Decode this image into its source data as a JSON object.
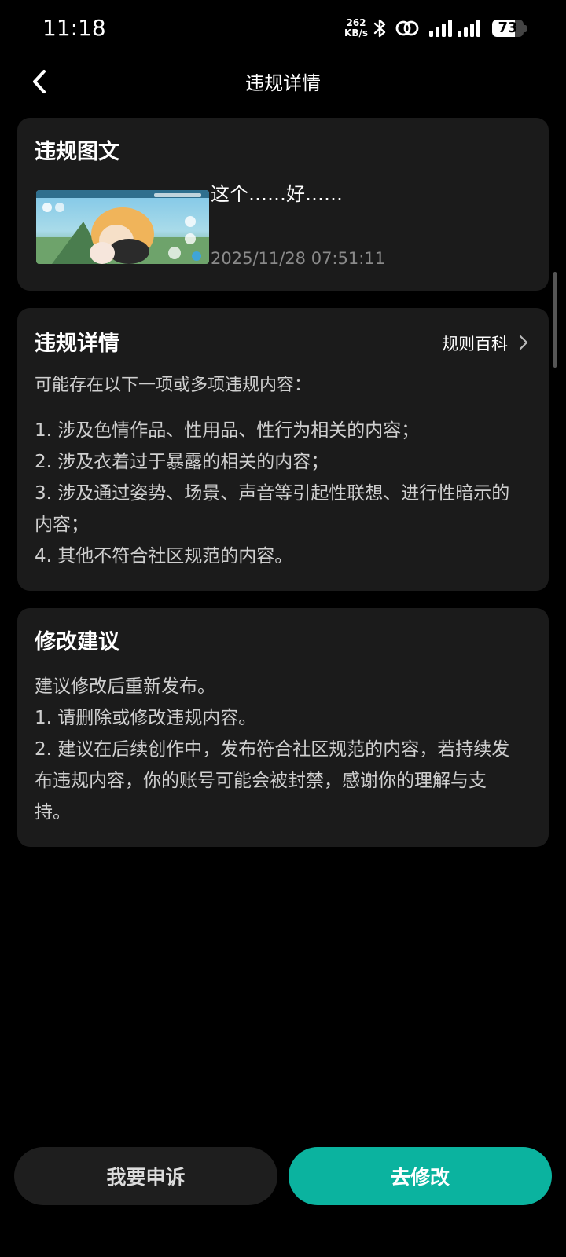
{
  "status_bar": {
    "time": "11:18",
    "net_speed_value": "262",
    "net_speed_unit": "KB/s",
    "battery_level": "73",
    "icons": [
      "bluetooth-icon",
      "link-icon",
      "signal-icon",
      "signal-icon"
    ]
  },
  "header": {
    "title": "违规详情",
    "back_icon": "chevron-left-icon"
  },
  "violation_post": {
    "title": "违规图文",
    "text": "这个……好……",
    "time": "2025/11/28 07:51:11",
    "thumbnail_icon": "game-screenshot-thumbnail"
  },
  "violation_details": {
    "title": "违规详情",
    "rules_link_label": "规则百科",
    "rules_link_icon": "chevron-right-icon",
    "intro": "可能存在以下一项或多项违规内容：",
    "items": [
      "1. 涉及色情作品、性用品、性行为相关的内容；",
      "2. 涉及衣着过于暴露的相关的内容；",
      "3. 涉及通过姿势、场景、声音等引起性联想、进行性暗示的内容；",
      "4. 其他不符合社区规范的内容。"
    ]
  },
  "suggestion": {
    "title": "修改建议",
    "lines": [
      "建议修改后重新发布。",
      "1. 请删除或修改违规内容。",
      "2. 建议在后续创作中，发布符合社区规范的内容，若持续发布违规内容，你的账号可能会被封禁，感谢你的理解与支持。"
    ]
  },
  "actions": {
    "appeal_label": "我要申诉",
    "modify_label": "去修改"
  },
  "colors": {
    "background": "#000000",
    "card": "#1b1b1b",
    "accent": "#0bb39f",
    "secondary_text": "#8a8a8a"
  }
}
